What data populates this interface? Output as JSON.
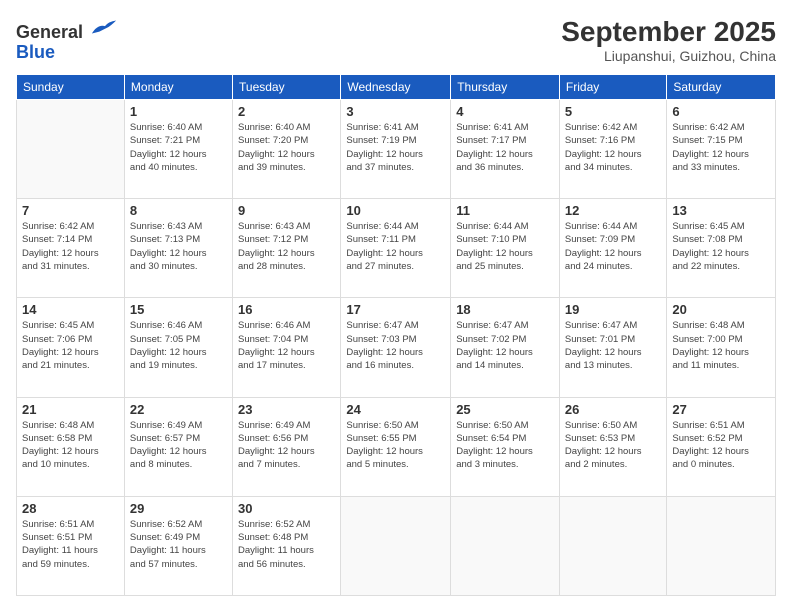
{
  "logo": {
    "line1": "General",
    "line2": "Blue"
  },
  "title": "September 2025",
  "subtitle": "Liupanshui, Guizhou, China",
  "weekdays": [
    "Sunday",
    "Monday",
    "Tuesday",
    "Wednesday",
    "Thursday",
    "Friday",
    "Saturday"
  ],
  "weeks": [
    [
      {
        "day": "",
        "info": ""
      },
      {
        "day": "1",
        "info": "Sunrise: 6:40 AM\nSunset: 7:21 PM\nDaylight: 12 hours\nand 40 minutes."
      },
      {
        "day": "2",
        "info": "Sunrise: 6:40 AM\nSunset: 7:20 PM\nDaylight: 12 hours\nand 39 minutes."
      },
      {
        "day": "3",
        "info": "Sunrise: 6:41 AM\nSunset: 7:19 PM\nDaylight: 12 hours\nand 37 minutes."
      },
      {
        "day": "4",
        "info": "Sunrise: 6:41 AM\nSunset: 7:17 PM\nDaylight: 12 hours\nand 36 minutes."
      },
      {
        "day": "5",
        "info": "Sunrise: 6:42 AM\nSunset: 7:16 PM\nDaylight: 12 hours\nand 34 minutes."
      },
      {
        "day": "6",
        "info": "Sunrise: 6:42 AM\nSunset: 7:15 PM\nDaylight: 12 hours\nand 33 minutes."
      }
    ],
    [
      {
        "day": "7",
        "info": "Sunrise: 6:42 AM\nSunset: 7:14 PM\nDaylight: 12 hours\nand 31 minutes."
      },
      {
        "day": "8",
        "info": "Sunrise: 6:43 AM\nSunset: 7:13 PM\nDaylight: 12 hours\nand 30 minutes."
      },
      {
        "day": "9",
        "info": "Sunrise: 6:43 AM\nSunset: 7:12 PM\nDaylight: 12 hours\nand 28 minutes."
      },
      {
        "day": "10",
        "info": "Sunrise: 6:44 AM\nSunset: 7:11 PM\nDaylight: 12 hours\nand 27 minutes."
      },
      {
        "day": "11",
        "info": "Sunrise: 6:44 AM\nSunset: 7:10 PM\nDaylight: 12 hours\nand 25 minutes."
      },
      {
        "day": "12",
        "info": "Sunrise: 6:44 AM\nSunset: 7:09 PM\nDaylight: 12 hours\nand 24 minutes."
      },
      {
        "day": "13",
        "info": "Sunrise: 6:45 AM\nSunset: 7:08 PM\nDaylight: 12 hours\nand 22 minutes."
      }
    ],
    [
      {
        "day": "14",
        "info": "Sunrise: 6:45 AM\nSunset: 7:06 PM\nDaylight: 12 hours\nand 21 minutes."
      },
      {
        "day": "15",
        "info": "Sunrise: 6:46 AM\nSunset: 7:05 PM\nDaylight: 12 hours\nand 19 minutes."
      },
      {
        "day": "16",
        "info": "Sunrise: 6:46 AM\nSunset: 7:04 PM\nDaylight: 12 hours\nand 17 minutes."
      },
      {
        "day": "17",
        "info": "Sunrise: 6:47 AM\nSunset: 7:03 PM\nDaylight: 12 hours\nand 16 minutes."
      },
      {
        "day": "18",
        "info": "Sunrise: 6:47 AM\nSunset: 7:02 PM\nDaylight: 12 hours\nand 14 minutes."
      },
      {
        "day": "19",
        "info": "Sunrise: 6:47 AM\nSunset: 7:01 PM\nDaylight: 12 hours\nand 13 minutes."
      },
      {
        "day": "20",
        "info": "Sunrise: 6:48 AM\nSunset: 7:00 PM\nDaylight: 12 hours\nand 11 minutes."
      }
    ],
    [
      {
        "day": "21",
        "info": "Sunrise: 6:48 AM\nSunset: 6:58 PM\nDaylight: 12 hours\nand 10 minutes."
      },
      {
        "day": "22",
        "info": "Sunrise: 6:49 AM\nSunset: 6:57 PM\nDaylight: 12 hours\nand 8 minutes."
      },
      {
        "day": "23",
        "info": "Sunrise: 6:49 AM\nSunset: 6:56 PM\nDaylight: 12 hours\nand 7 minutes."
      },
      {
        "day": "24",
        "info": "Sunrise: 6:50 AM\nSunset: 6:55 PM\nDaylight: 12 hours\nand 5 minutes."
      },
      {
        "day": "25",
        "info": "Sunrise: 6:50 AM\nSunset: 6:54 PM\nDaylight: 12 hours\nand 3 minutes."
      },
      {
        "day": "26",
        "info": "Sunrise: 6:50 AM\nSunset: 6:53 PM\nDaylight: 12 hours\nand 2 minutes."
      },
      {
        "day": "27",
        "info": "Sunrise: 6:51 AM\nSunset: 6:52 PM\nDaylight: 12 hours\nand 0 minutes."
      }
    ],
    [
      {
        "day": "28",
        "info": "Sunrise: 6:51 AM\nSunset: 6:51 PM\nDaylight: 11 hours\nand 59 minutes."
      },
      {
        "day": "29",
        "info": "Sunrise: 6:52 AM\nSunset: 6:49 PM\nDaylight: 11 hours\nand 57 minutes."
      },
      {
        "day": "30",
        "info": "Sunrise: 6:52 AM\nSunset: 6:48 PM\nDaylight: 11 hours\nand 56 minutes."
      },
      {
        "day": "",
        "info": ""
      },
      {
        "day": "",
        "info": ""
      },
      {
        "day": "",
        "info": ""
      },
      {
        "day": "",
        "info": ""
      }
    ]
  ]
}
